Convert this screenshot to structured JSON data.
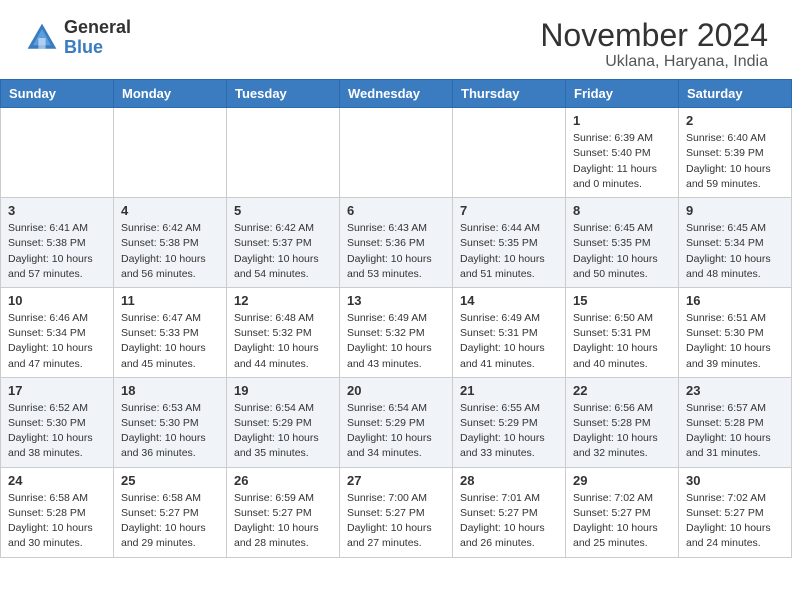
{
  "header": {
    "logo_general": "General",
    "logo_blue": "Blue",
    "title": "November 2024",
    "subtitle": "Uklana, Haryana, India"
  },
  "weekdays": [
    "Sunday",
    "Monday",
    "Tuesday",
    "Wednesday",
    "Thursday",
    "Friday",
    "Saturday"
  ],
  "weeks": [
    [
      {
        "day": "",
        "info": ""
      },
      {
        "day": "",
        "info": ""
      },
      {
        "day": "",
        "info": ""
      },
      {
        "day": "",
        "info": ""
      },
      {
        "day": "",
        "info": ""
      },
      {
        "day": "1",
        "info": "Sunrise: 6:39 AM\nSunset: 5:40 PM\nDaylight: 11 hours and 0 minutes."
      },
      {
        "day": "2",
        "info": "Sunrise: 6:40 AM\nSunset: 5:39 PM\nDaylight: 10 hours and 59 minutes."
      }
    ],
    [
      {
        "day": "3",
        "info": "Sunrise: 6:41 AM\nSunset: 5:38 PM\nDaylight: 10 hours and 57 minutes."
      },
      {
        "day": "4",
        "info": "Sunrise: 6:42 AM\nSunset: 5:38 PM\nDaylight: 10 hours and 56 minutes."
      },
      {
        "day": "5",
        "info": "Sunrise: 6:42 AM\nSunset: 5:37 PM\nDaylight: 10 hours and 54 minutes."
      },
      {
        "day": "6",
        "info": "Sunrise: 6:43 AM\nSunset: 5:36 PM\nDaylight: 10 hours and 53 minutes."
      },
      {
        "day": "7",
        "info": "Sunrise: 6:44 AM\nSunset: 5:35 PM\nDaylight: 10 hours and 51 minutes."
      },
      {
        "day": "8",
        "info": "Sunrise: 6:45 AM\nSunset: 5:35 PM\nDaylight: 10 hours and 50 minutes."
      },
      {
        "day": "9",
        "info": "Sunrise: 6:45 AM\nSunset: 5:34 PM\nDaylight: 10 hours and 48 minutes."
      }
    ],
    [
      {
        "day": "10",
        "info": "Sunrise: 6:46 AM\nSunset: 5:34 PM\nDaylight: 10 hours and 47 minutes."
      },
      {
        "day": "11",
        "info": "Sunrise: 6:47 AM\nSunset: 5:33 PM\nDaylight: 10 hours and 45 minutes."
      },
      {
        "day": "12",
        "info": "Sunrise: 6:48 AM\nSunset: 5:32 PM\nDaylight: 10 hours and 44 minutes."
      },
      {
        "day": "13",
        "info": "Sunrise: 6:49 AM\nSunset: 5:32 PM\nDaylight: 10 hours and 43 minutes."
      },
      {
        "day": "14",
        "info": "Sunrise: 6:49 AM\nSunset: 5:31 PM\nDaylight: 10 hours and 41 minutes."
      },
      {
        "day": "15",
        "info": "Sunrise: 6:50 AM\nSunset: 5:31 PM\nDaylight: 10 hours and 40 minutes."
      },
      {
        "day": "16",
        "info": "Sunrise: 6:51 AM\nSunset: 5:30 PM\nDaylight: 10 hours and 39 minutes."
      }
    ],
    [
      {
        "day": "17",
        "info": "Sunrise: 6:52 AM\nSunset: 5:30 PM\nDaylight: 10 hours and 38 minutes."
      },
      {
        "day": "18",
        "info": "Sunrise: 6:53 AM\nSunset: 5:30 PM\nDaylight: 10 hours and 36 minutes."
      },
      {
        "day": "19",
        "info": "Sunrise: 6:54 AM\nSunset: 5:29 PM\nDaylight: 10 hours and 35 minutes."
      },
      {
        "day": "20",
        "info": "Sunrise: 6:54 AM\nSunset: 5:29 PM\nDaylight: 10 hours and 34 minutes."
      },
      {
        "day": "21",
        "info": "Sunrise: 6:55 AM\nSunset: 5:29 PM\nDaylight: 10 hours and 33 minutes."
      },
      {
        "day": "22",
        "info": "Sunrise: 6:56 AM\nSunset: 5:28 PM\nDaylight: 10 hours and 32 minutes."
      },
      {
        "day": "23",
        "info": "Sunrise: 6:57 AM\nSunset: 5:28 PM\nDaylight: 10 hours and 31 minutes."
      }
    ],
    [
      {
        "day": "24",
        "info": "Sunrise: 6:58 AM\nSunset: 5:28 PM\nDaylight: 10 hours and 30 minutes."
      },
      {
        "day": "25",
        "info": "Sunrise: 6:58 AM\nSunset: 5:27 PM\nDaylight: 10 hours and 29 minutes."
      },
      {
        "day": "26",
        "info": "Sunrise: 6:59 AM\nSunset: 5:27 PM\nDaylight: 10 hours and 28 minutes."
      },
      {
        "day": "27",
        "info": "Sunrise: 7:00 AM\nSunset: 5:27 PM\nDaylight: 10 hours and 27 minutes."
      },
      {
        "day": "28",
        "info": "Sunrise: 7:01 AM\nSunset: 5:27 PM\nDaylight: 10 hours and 26 minutes."
      },
      {
        "day": "29",
        "info": "Sunrise: 7:02 AM\nSunset: 5:27 PM\nDaylight: 10 hours and 25 minutes."
      },
      {
        "day": "30",
        "info": "Sunrise: 7:02 AM\nSunset: 5:27 PM\nDaylight: 10 hours and 24 minutes."
      }
    ]
  ]
}
